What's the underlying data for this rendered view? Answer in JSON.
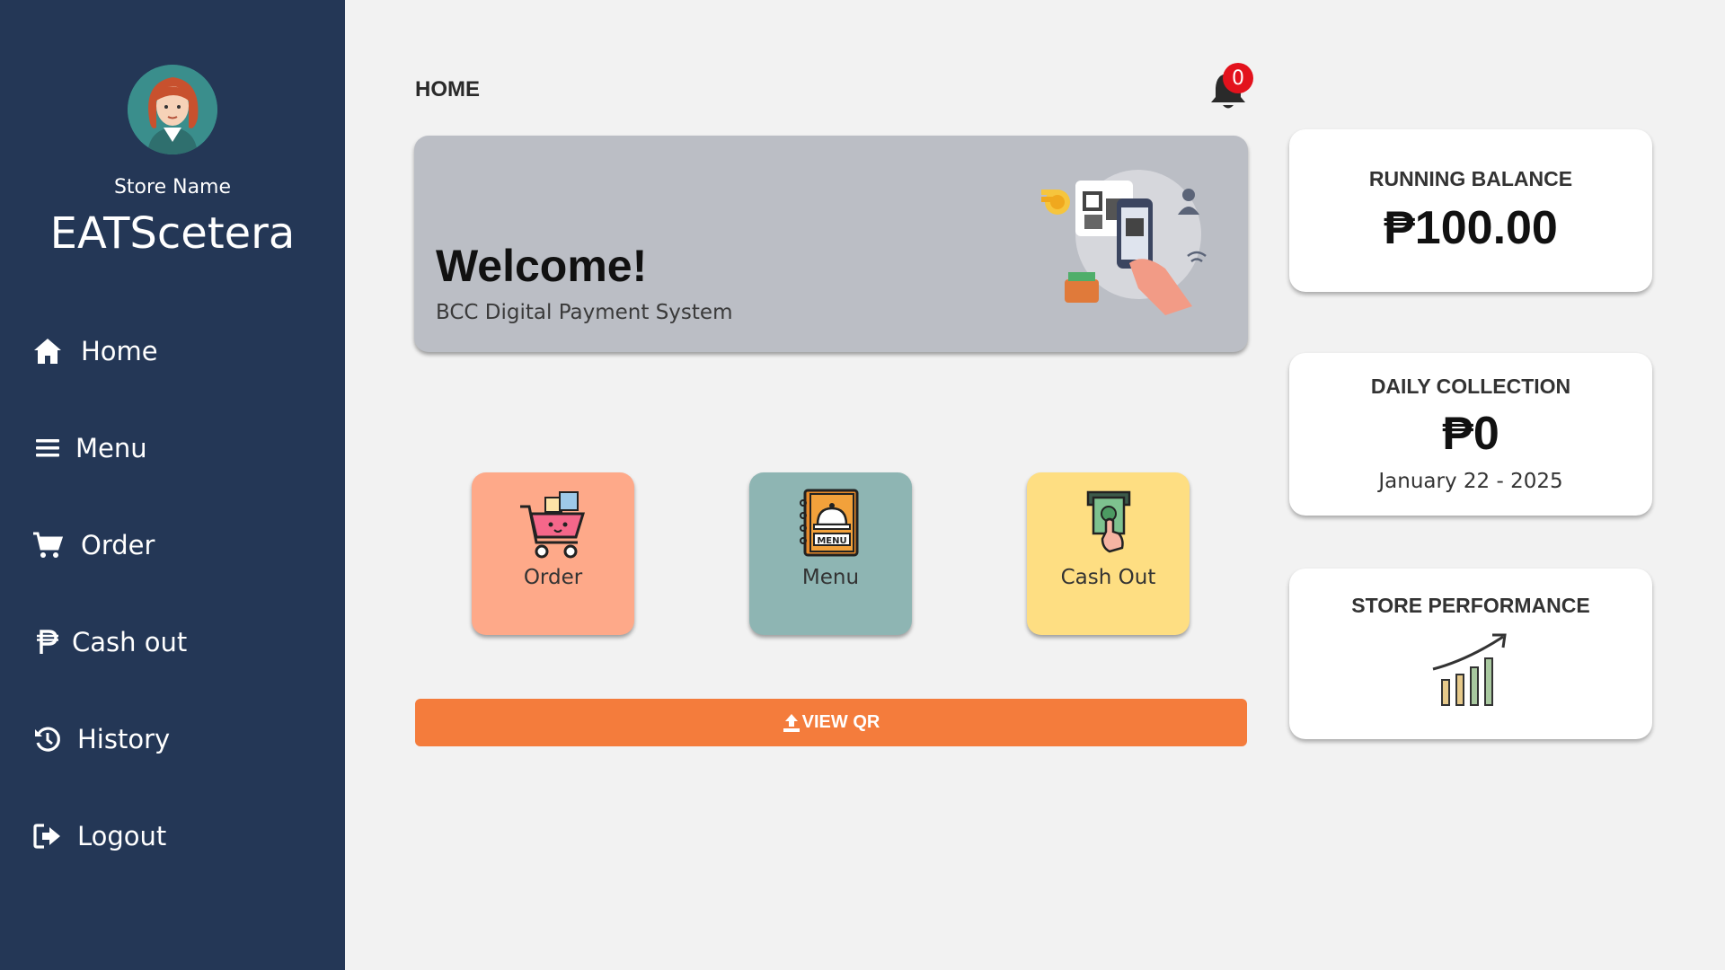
{
  "sidebar": {
    "store_label": "Store Name",
    "store_name": "EATScetera",
    "items": [
      {
        "label": "Home",
        "icon": "home-icon"
      },
      {
        "label": "Menu",
        "icon": "menu-lines-icon"
      },
      {
        "label": "Order",
        "icon": "cart-icon"
      },
      {
        "label": "Cash out",
        "icon": "peso-icon"
      },
      {
        "label": "History",
        "icon": "history-icon"
      },
      {
        "label": "Logout",
        "icon": "logout-icon"
      }
    ]
  },
  "header": {
    "title": "HOME",
    "notification_count": "0"
  },
  "welcome": {
    "heading": "Welcome!",
    "subtitle": "BCC Digital Payment System"
  },
  "tiles": [
    {
      "label": "Order",
      "icon": "shopping-cart-icon",
      "color": "#fea989"
    },
    {
      "label": "Menu",
      "icon": "menu-book-icon",
      "color": "#8eb5b3"
    },
    {
      "label": "Cash Out",
      "icon": "cash-out-icon",
      "color": "#fede82"
    }
  ],
  "view_qr": {
    "label": "VIEW QR"
  },
  "cards": {
    "balance": {
      "title": "RUNNING BALANCE",
      "value": "₱100.00"
    },
    "daily": {
      "title": "DAILY COLLECTION",
      "value": "₱0",
      "date": "January 22 - 2025"
    },
    "performance": {
      "title": "STORE PERFORMANCE",
      "icon": "growth-chart-icon"
    }
  },
  "colors": {
    "sidebar_bg": "#243756",
    "page_bg": "#f2f2f2",
    "accent": "#f47c3c",
    "badge": "#e3121d"
  }
}
